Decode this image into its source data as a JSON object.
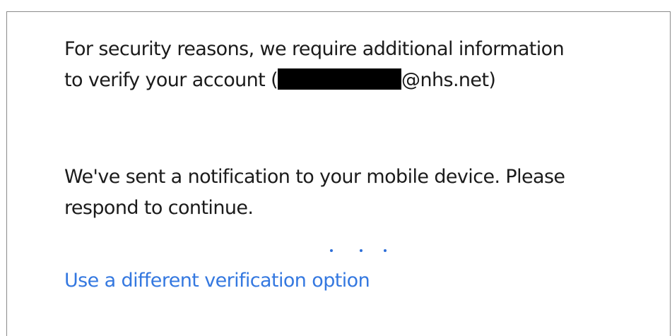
{
  "message": {
    "line1": "For security reasons, we require additional information",
    "line2_prefix": "to verify your account (",
    "line2_suffix": "@nhs.net)",
    "line3": "We've sent a notification to your mobile device. Please",
    "line4": "respond to continue."
  },
  "progress": {
    "indicator": "loading-dots"
  },
  "actions": {
    "different_option_label": "Use a different verification option"
  },
  "colors": {
    "text": "#1b1b1b",
    "link": "#3478e0",
    "border": "#8a8a8a",
    "redaction": "#000000"
  }
}
